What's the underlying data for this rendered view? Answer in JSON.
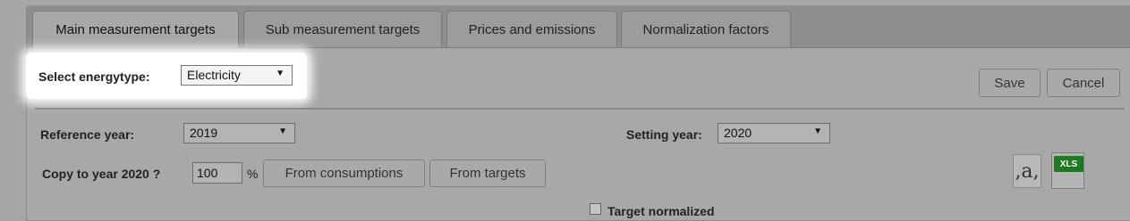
{
  "tabs": [
    {
      "label": "Main measurement targets",
      "active": true
    },
    {
      "label": "Sub measurement targets"
    },
    {
      "label": "Prices and emissions"
    },
    {
      "label": "Normalization factors"
    }
  ],
  "energytype": {
    "label": "Select energytype:",
    "value": "Electricity"
  },
  "actions": {
    "save": "Save",
    "cancel": "Cancel"
  },
  "reference_year": {
    "label": "Reference year:",
    "value": "2019"
  },
  "setting_year": {
    "label": "Setting year:",
    "value": "2020"
  },
  "copy": {
    "label": "Copy to year 2020 ?",
    "percent_value": "100",
    "percent_sign": "%",
    "from_consumptions": "From consumptions",
    "from_targets": "From targets"
  },
  "exports": {
    "csv_glyph": ",a,",
    "xls_label": "XLS"
  },
  "target_normalized": {
    "label": "Target normalized"
  },
  "colors": {
    "highlight": "#ffffff",
    "xls_green": "#1e7a1e",
    "overlay_gray": "#a6a6a6"
  }
}
